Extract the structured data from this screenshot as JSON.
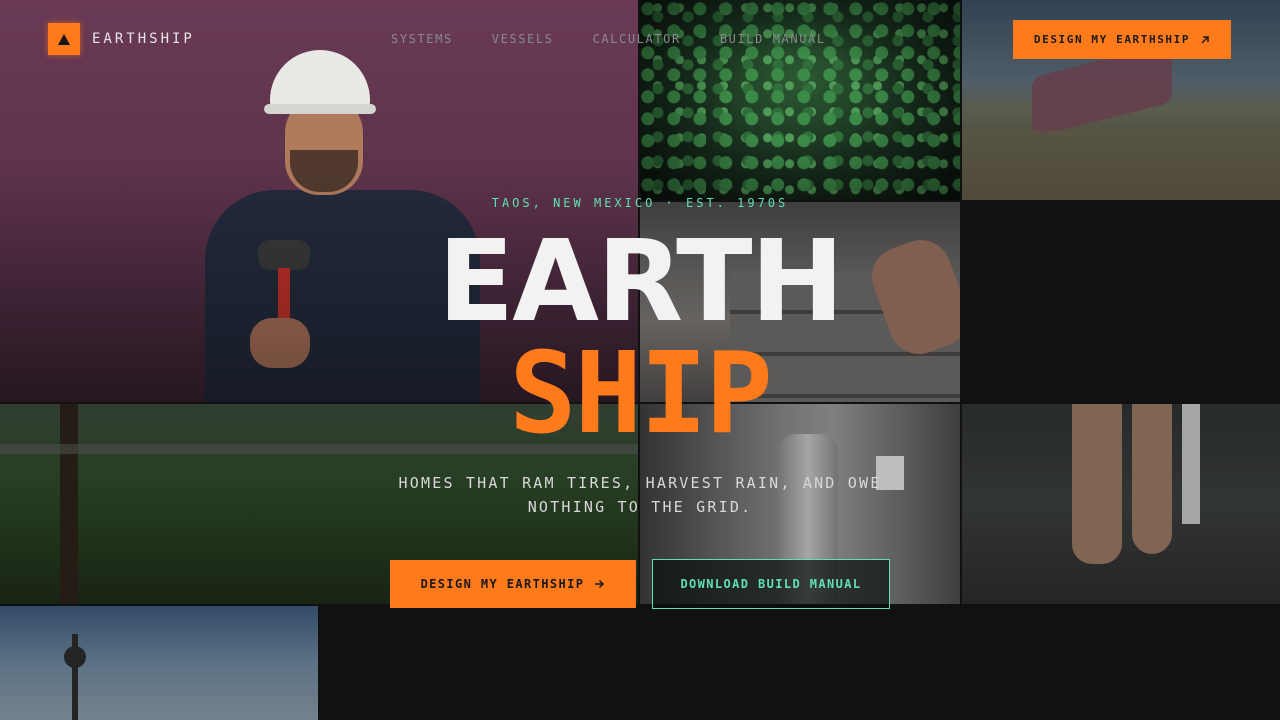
{
  "brand": {
    "name": "EARTHSHIP",
    "logo_icon": "triangle-icon"
  },
  "nav": {
    "links": [
      "SYSTEMS",
      "VESSELS",
      "CALCULATOR",
      "BUILD MANUAL"
    ],
    "cta_label": "DESIGN MY EARTHSHIP",
    "cta_icon": "arrow-up-right-icon"
  },
  "hero": {
    "eyebrow": "TAOS, NEW MEXICO · EST. 1970S",
    "title_line1": "EARTH",
    "title_line2": "SHIP",
    "tagline": "HOMES THAT RAM TIRES, HARVEST RAIN, AND OWE NOTHING TO THE GRID.",
    "primary_label": "DESIGN MY EARTHSHIP",
    "primary_icon": "arrow-right-icon",
    "secondary_label": "DOWNLOAD BUILD MANUAL"
  },
  "colors": {
    "accent": "#ff7a1a",
    "mint": "#5fe0b4",
    "background": "#111112"
  }
}
